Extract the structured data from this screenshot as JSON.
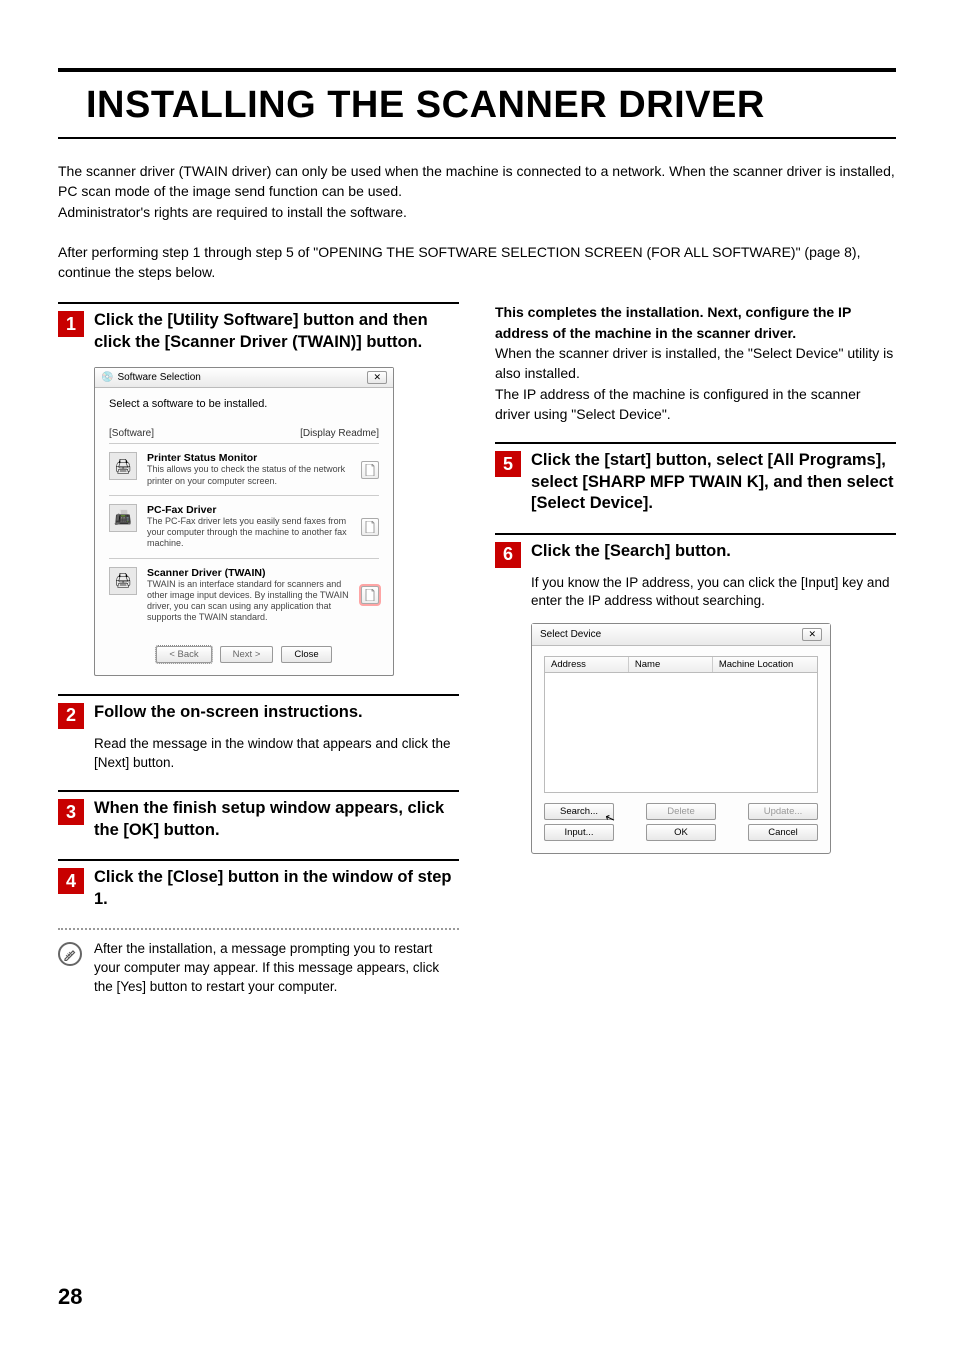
{
  "pageNumber": "28",
  "title": "INSTALLING THE SCANNER DRIVER",
  "intro1": "The scanner driver (TWAIN driver) can only be used when the machine is connected to a network. When the scanner driver is installed, PC scan mode of the image send function can be used.\nAdministrator's rights are required to install the software.",
  "intro2": "After performing step 1 through step 5 of \"OPENING THE SOFTWARE SELECTION SCREEN (FOR ALL SOFTWARE)\" (page 8), continue the steps below.",
  "steps": {
    "s1": {
      "num": "1",
      "title": "Click the [Utility Software] button and then click the [Scanner Driver (TWAIN)] button."
    },
    "s2": {
      "num": "2",
      "title": "Follow the on-screen instructions.",
      "body": "Read the message in the window that appears and click the [Next] button."
    },
    "s3": {
      "num": "3",
      "title": "When the finish setup window appears, click the [OK] button."
    },
    "s4": {
      "num": "4",
      "title": "Click the [Close] button in the window of step 1."
    },
    "s5": {
      "num": "5",
      "title": "Click the [start] button, select [All Programs], select [SHARP MFP TWAIN K], and then select [Select Device]."
    },
    "s6": {
      "num": "6",
      "title": "Click the [Search] button.",
      "body": "If you know the IP address, you can click the [Input] key and enter the IP address without searching."
    }
  },
  "note": "After the installation, a message prompting you to restart your computer may appear. If this message appears, click the [Yes] button to restart your computer.",
  "rightIntro": {
    "boldLine": "This completes the installation. Next, configure the IP address of the machine in the scanner driver.",
    "line2": "When the scanner driver is installed, the \"Select Device\" utility is also installed.",
    "line3": "The IP address of the machine is configured in the scanner driver using \"Select Device\"."
  },
  "fig1": {
    "windowTitle": "Software Selection",
    "instruction": "Select a software to be installed.",
    "labelSoftware": "[Software]",
    "labelReadme": "[Display Readme]",
    "items": [
      {
        "title": "Printer Status Monitor",
        "desc": "This allows you to check the status of the network printer on your computer screen."
      },
      {
        "title": "PC-Fax Driver",
        "desc": "The PC-Fax driver lets you easily send faxes from your computer through the machine to another fax machine."
      },
      {
        "title": "Scanner Driver (TWAIN)",
        "desc": "TWAIN is an interface standard for scanners and other image input devices. By installing the TWAIN driver, you can scan using any application that supports the TWAIN standard."
      }
    ],
    "buttons": {
      "back": "< Back",
      "next": "Next >",
      "close": "Close"
    }
  },
  "fig2": {
    "windowTitle": "Select Device",
    "headers": {
      "address": "Address",
      "name": "Name",
      "location": "Machine Location"
    },
    "buttons": {
      "search": "Search...",
      "delete": "Delete",
      "update": "Update...",
      "input": "Input...",
      "ok": "OK",
      "cancel": "Cancel"
    }
  }
}
